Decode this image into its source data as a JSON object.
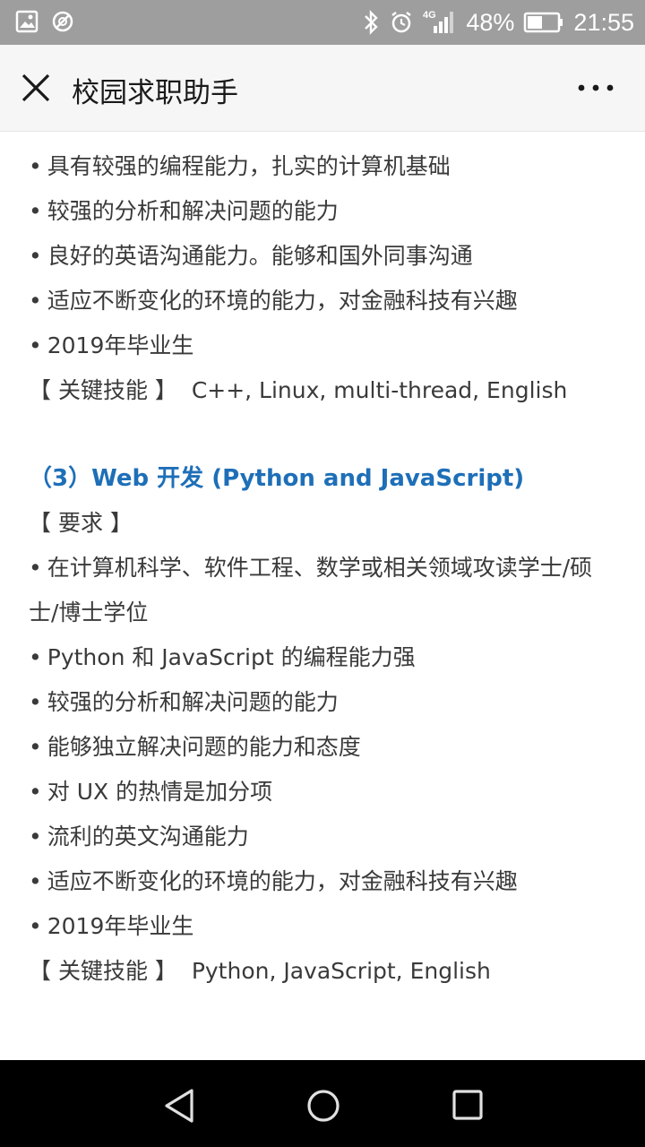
{
  "status_bar": {
    "battery": "48%",
    "time": "21:55",
    "network": "4G",
    "icons": [
      "image-icon",
      "no-disturb-icon",
      "bluetooth-icon",
      "alarm-icon",
      "signal-icon",
      "battery-icon"
    ]
  },
  "app_bar": {
    "title": "校园求职助手",
    "close_icon": "close-icon",
    "more_icon": "more-icon"
  },
  "content": {
    "section2_items": [
      "具有较强的编程能力，扎实的计算机基础",
      "较强的分析和解决问题的能力",
      "良好的英语沟通能力。能够和国外同事沟通",
      "适应不断变化的环境的能力，对金融科技有兴趣",
      "2019年毕业生"
    ],
    "section2_skills_label": "【 关键技能 】",
    "section2_skills": "C++, Linux, multi-thread, English",
    "section3_title": "（3）Web 开发 (Python and JavaScript)",
    "section3_req_label": "【 要求 】",
    "section3_items": [
      "在计算机科学、软件工程、数学或相关领域攻读学士/硕士/博士学位",
      "Python 和 JavaScript 的编程能力强",
      "较强的分析和解决问题的能力",
      "能够独立解决问题的能力和态度",
      "对 UX 的热情是加分项",
      "流利的英文沟通能力",
      "适应不断变化的环境的能力，对金融科技有兴趣",
      "2019年毕业生"
    ],
    "section3_skills_label": "【 关键技能 】",
    "section3_skills": "Python, JavaScript, English",
    "bullet": "•"
  },
  "nav_bar": {
    "icons": [
      "back-icon",
      "home-icon",
      "recents-icon"
    ]
  }
}
